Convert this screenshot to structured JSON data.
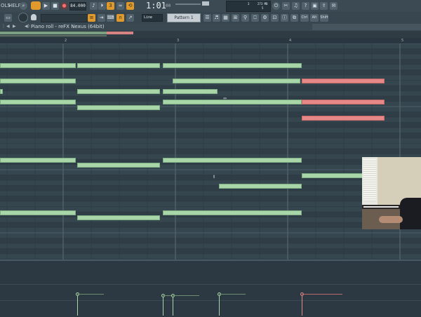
{
  "toolbar": {
    "menu_tools": "OLS",
    "menu_help": "HELP",
    "tempo": "84.000",
    "time_main": "1:01",
    "time_sub": "00",
    "cpu_mb": "273 MB",
    "cpu_val1": "3",
    "cpu_val2": "5",
    "snap_value": "Line",
    "pattern_label": "Pattern 1",
    "btn_ctrl": "Ctrl",
    "btn_alt": "Alt",
    "btn_shift": "Shift"
  },
  "piano_roll": {
    "title": "Piano roll - reFX Nexus (64bit)",
    "bars": [
      "2",
      "3",
      "4",
      "5"
    ]
  },
  "colors": {
    "note_green": "#a8d6a9",
    "note_red": "#e48888",
    "grid_bg": "#34444e",
    "accent_orange": "#e09a2b"
  },
  "notes": [
    {
      "start": 0.0,
      "len": 1.12,
      "row": 1,
      "sel": false
    },
    {
      "start": 1.12,
      "len": 0.75,
      "row": 1,
      "sel": false
    },
    {
      "start": 1.88,
      "len": 1.25,
      "row": 1,
      "sel": false
    },
    {
      "start": 0.0,
      "len": 1.12,
      "row": 4,
      "sel": false
    },
    {
      "start": 1.97,
      "len": 1.15,
      "row": 4,
      "sel": false
    },
    {
      "start": 3.12,
      "len": 0.75,
      "row": 4,
      "sel": true
    },
    {
      "start": 0.0,
      "len": 0.38,
      "row": 6,
      "sel": false
    },
    {
      "start": 1.12,
      "len": 0.75,
      "row": 6,
      "sel": false
    },
    {
      "start": 1.88,
      "len": 0.5,
      "row": 6,
      "sel": false
    },
    {
      "start": 0.0,
      "len": 1.12,
      "row": 8,
      "sel": false
    },
    {
      "start": 1.88,
      "len": 1.25,
      "row": 8,
      "sel": false
    },
    {
      "start": 3.12,
      "len": 0.75,
      "row": 8,
      "sel": true
    },
    {
      "start": 1.12,
      "len": 0.75,
      "row": 9,
      "sel": false
    },
    {
      "start": 3.12,
      "len": 0.75,
      "row": 11,
      "sel": true
    },
    {
      "start": 0.0,
      "len": 1.12,
      "row": 19,
      "sel": false
    },
    {
      "start": 1.88,
      "len": 1.25,
      "row": 19,
      "sel": false
    },
    {
      "start": 1.12,
      "len": 0.75,
      "row": 20,
      "sel": false
    },
    {
      "start": 3.12,
      "len": 0.75,
      "row": 22,
      "sel": false
    },
    {
      "start": 2.38,
      "len": 0.75,
      "row": 24,
      "sel": false
    },
    {
      "start": 0.0,
      "len": 1.12,
      "row": 29,
      "sel": false
    },
    {
      "start": 1.88,
      "len": 1.25,
      "row": 29,
      "sel": false
    },
    {
      "start": 1.12,
      "len": 0.75,
      "row": 30,
      "sel": false
    }
  ],
  "velocity_stems": [
    {
      "pos": 1.12,
      "level": 0.72,
      "sel": false
    },
    {
      "pos": 1.88,
      "level": 0.68,
      "sel": false
    },
    {
      "pos": 1.97,
      "level": 0.68,
      "sel": false
    },
    {
      "pos": 2.38,
      "level": 0.72,
      "sel": false
    },
    {
      "pos": 3.12,
      "level": 0.72,
      "sel": true
    }
  ]
}
